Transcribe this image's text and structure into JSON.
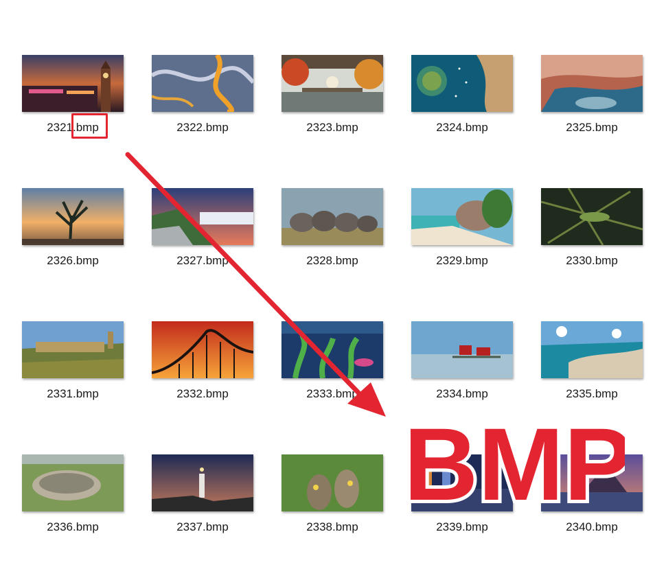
{
  "files": [
    {
      "name": "2321.bmp",
      "scene": "castle-clock-tower-dusk"
    },
    {
      "name": "2322.bmp",
      "scene": "aerial-river-swirl"
    },
    {
      "name": "2323.bmp",
      "scene": "autumn-temple-garden"
    },
    {
      "name": "2324.bmp",
      "scene": "aerial-island-boats"
    },
    {
      "name": "2325.bmp",
      "scene": "red-rock-cave"
    },
    {
      "name": "2326.bmp",
      "scene": "joshua-tree-sunset"
    },
    {
      "name": "2327.bmp",
      "scene": "mountain-ridge-clouds"
    },
    {
      "name": "2328.bmp",
      "scene": "elephant-herd"
    },
    {
      "name": "2329.bmp",
      "scene": "granite-beach"
    },
    {
      "name": "2330.bmp",
      "scene": "chameleon-ferns"
    },
    {
      "name": "2331.bmp",
      "scene": "hill-fortress"
    },
    {
      "name": "2332.bmp",
      "scene": "roller-coaster-sunset"
    },
    {
      "name": "2333.bmp",
      "scene": "underwater-plants"
    },
    {
      "name": "2334.bmp",
      "scene": "red-cottages-lake"
    },
    {
      "name": "2335.bmp",
      "scene": "coastal-town-aerial"
    },
    {
      "name": "2336.bmp",
      "scene": "stone-circle-meadow"
    },
    {
      "name": "2337.bmp",
      "scene": "lighthouse-night"
    },
    {
      "name": "2338.bmp",
      "scene": "burrowing-owls"
    },
    {
      "name": "2339.bmp",
      "scene": "city-skyline-night"
    },
    {
      "name": "2340.bmp",
      "scene": "mountain-bay-dusk"
    }
  ],
  "overlay": {
    "badge_text": "BMP",
    "accent_color": "#e32532",
    "highlighted_file": "2321.bmp",
    "highlighted_part": ".bmp"
  }
}
